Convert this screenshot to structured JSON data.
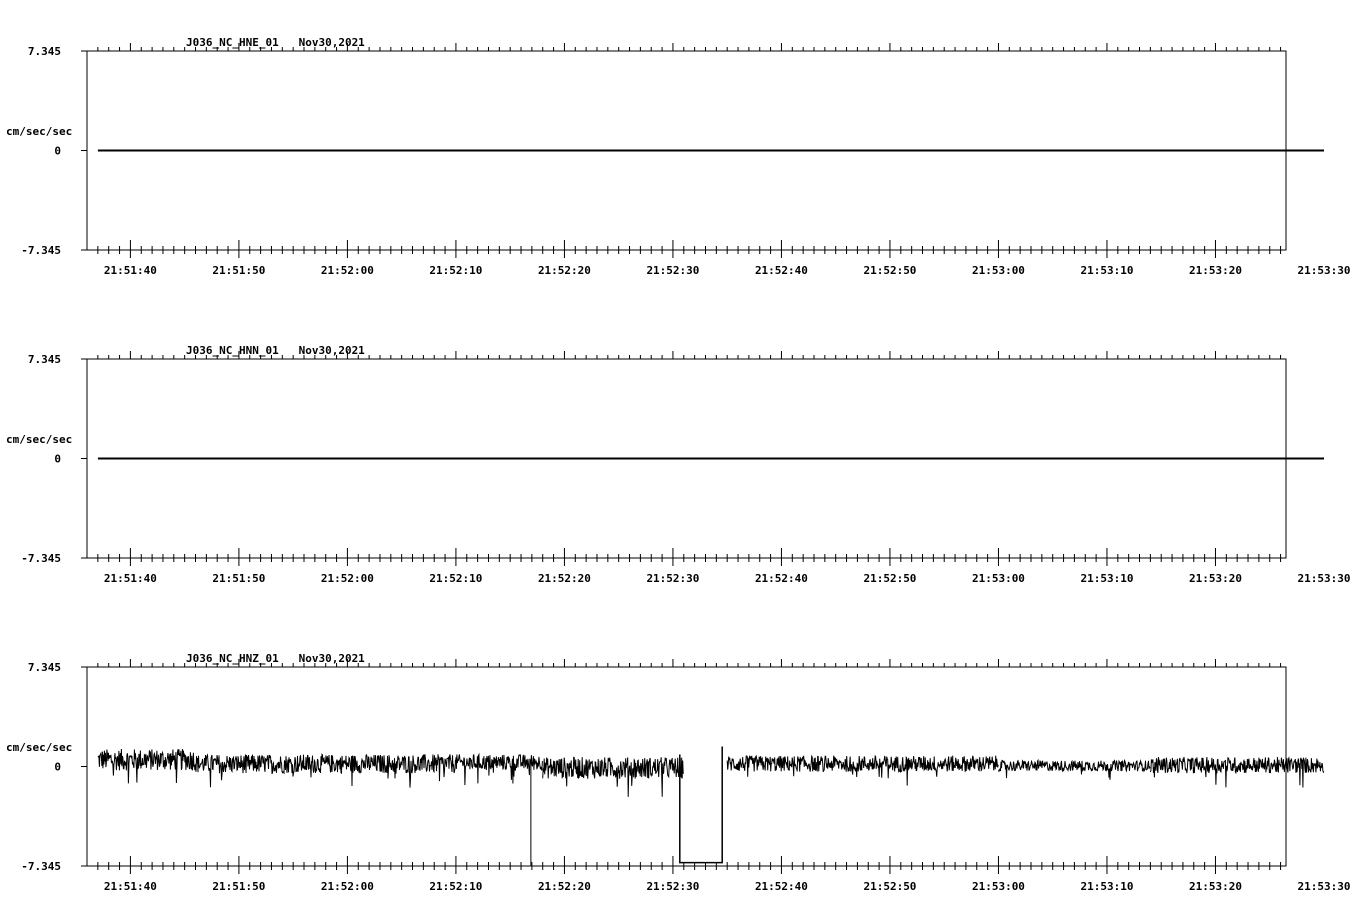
{
  "chart_data": [
    {
      "type": "line",
      "title": "J036_NC_HNE_01   Nov30,2021",
      "ylabel": "cm/sec/sec",
      "ylim": [
        -7.345,
        7.345
      ],
      "ytick_labels": [
        "7.345",
        "0",
        "-7.345"
      ],
      "xlim_seconds": [
        96.0,
        206.5
      ],
      "xtick_labels": [
        "21:51:40",
        "21:51:50",
        "21:52:00",
        "21:52:10",
        "21:52:20",
        "21:52:30",
        "21:52:40",
        "21:52:50",
        "21:53:00",
        "21:53:10",
        "21:53:20",
        "21:53:30"
      ],
      "series": [
        {
          "x": [
            "21:51:37",
            "21:53:30"
          ],
          "y": [
            0,
            0
          ],
          "color": "#000000"
        }
      ],
      "grid": false
    },
    {
      "type": "line",
      "title": "J036_NC_HNN_01   Nov30,2021",
      "ylabel": "cm/sec/sec",
      "ylim": [
        -7.345,
        7.345
      ],
      "ytick_labels": [
        "7.345",
        "0",
        "-7.345"
      ],
      "xtick_labels": [
        "21:51:40",
        "21:51:50",
        "21:52:00",
        "21:52:10",
        "21:52:20",
        "21:52:30",
        "21:52:40",
        "21:52:50",
        "21:53:00",
        "21:53:10",
        "21:53:20",
        "21:53:30"
      ],
      "series": [
        {
          "x": [
            "21:51:37",
            "21:53:30"
          ],
          "y": [
            0,
            0
          ],
          "color": "#000000"
        }
      ],
      "grid": false
    },
    {
      "type": "line",
      "title": "J036_NC_HNZ_01   Nov30,2021",
      "ylabel": "cm/sec/sec",
      "ylim": [
        -7.345,
        7.345
      ],
      "ytick_labels": [
        "7.345",
        "0",
        "-7.345"
      ],
      "xtick_labels": [
        "21:51:40",
        "21:51:50",
        "21:52:00",
        "21:52:10",
        "21:52:20",
        "21:52:30",
        "21:52:40",
        "21:52:50",
        "21:53:00",
        "21:53:10",
        "21:53:20",
        "21:53:30"
      ],
      "series": [
        {
          "color": "#000000",
          "noise_segments": [
            {
              "x": [
                "21:51:37",
                "21:51:46"
              ],
              "mean": 0.5,
              "amp": 0.8
            },
            {
              "x": [
                "21:51:46",
                "21:52:10"
              ],
              "mean": 0.2,
              "amp": 0.7
            },
            {
              "x": [
                "21:52:10",
                "21:52:18"
              ],
              "mean": 0.3,
              "amp": 0.6
            },
            {
              "x": [
                "21:52:18",
                "21:52:31"
              ],
              "mean": -0.1,
              "amp": 0.8
            },
            {
              "x": [
                "21:52:35",
                "21:53:00"
              ],
              "mean": 0.2,
              "amp": 0.6
            },
            {
              "x": [
                "21:53:00",
                "21:53:14"
              ],
              "mean": 0.05,
              "amp": 0.4
            },
            {
              "x": [
                "21:53:14",
                "21:53:30"
              ],
              "mean": 0.1,
              "amp": 0.6
            }
          ],
          "spikes": [
            {
              "x": "21:52:17",
              "y_min": -7.3,
              "y_max": 0.3
            }
          ],
          "flat_segments": [
            {
              "x": [
                "21:52:31",
                "21:52:35"
              ],
              "y": -6.5
            }
          ]
        }
      ],
      "grid": false
    }
  ]
}
